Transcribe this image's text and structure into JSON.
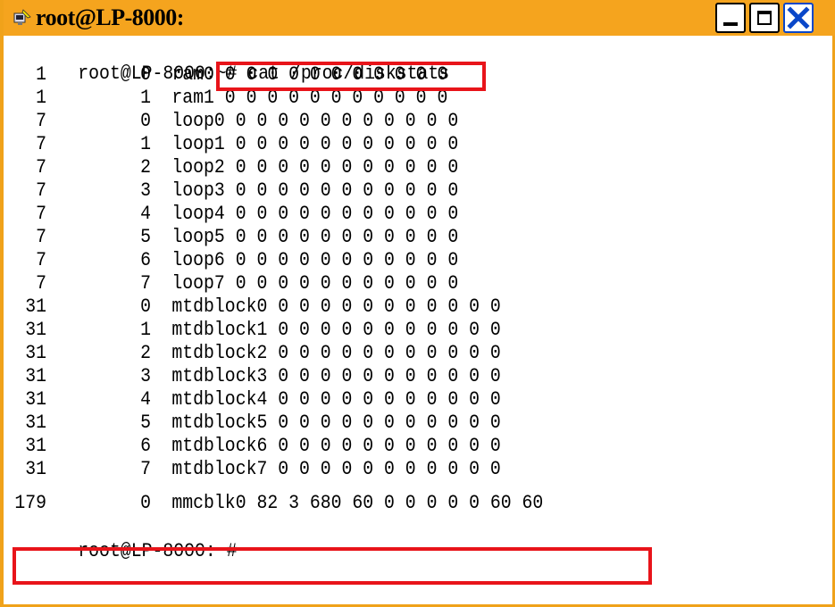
{
  "window": {
    "title": "root@LP-8000:",
    "controls": [
      "minimize",
      "maximize",
      "close"
    ],
    "accent_color": "#f5a41e",
    "highlight_color": "#e8141a"
  },
  "terminal": {
    "prompt": "root@LP-8000:~#",
    "command": "cat /proc/diskstats",
    "rows": [
      {
        "major": "1",
        "minor": "0",
        "rest": "ram0 0 0 0 0 0 0 0 0 0 0 0"
      },
      {
        "major": "1",
        "minor": "1",
        "rest": "ram1 0 0 0 0 0 0 0 0 0 0 0"
      },
      {
        "major": "7",
        "minor": "0",
        "rest": "loop0 0 0 0 0 0 0 0 0 0 0 0"
      },
      {
        "major": "7",
        "minor": "1",
        "rest": "loop1 0 0 0 0 0 0 0 0 0 0 0"
      },
      {
        "major": "7",
        "minor": "2",
        "rest": "loop2 0 0 0 0 0 0 0 0 0 0 0"
      },
      {
        "major": "7",
        "minor": "3",
        "rest": "loop3 0 0 0 0 0 0 0 0 0 0 0"
      },
      {
        "major": "7",
        "minor": "4",
        "rest": "loop4 0 0 0 0 0 0 0 0 0 0 0"
      },
      {
        "major": "7",
        "minor": "5",
        "rest": "loop5 0 0 0 0 0 0 0 0 0 0 0"
      },
      {
        "major": "7",
        "minor": "6",
        "rest": "loop6 0 0 0 0 0 0 0 0 0 0 0"
      },
      {
        "major": "7",
        "minor": "7",
        "rest": "loop7 0 0 0 0 0 0 0 0 0 0 0"
      },
      {
        "major": "31",
        "minor": "0",
        "rest": "mtdblock0 0 0 0 0 0 0 0 0 0 0 0"
      },
      {
        "major": "31",
        "minor": "1",
        "rest": "mtdblock1 0 0 0 0 0 0 0 0 0 0 0"
      },
      {
        "major": "31",
        "minor": "2",
        "rest": "mtdblock2 0 0 0 0 0 0 0 0 0 0 0"
      },
      {
        "major": "31",
        "minor": "3",
        "rest": "mtdblock3 0 0 0 0 0 0 0 0 0 0 0"
      },
      {
        "major": "31",
        "minor": "4",
        "rest": "mtdblock4 0 0 0 0 0 0 0 0 0 0 0"
      },
      {
        "major": "31",
        "minor": "5",
        "rest": "mtdblock5 0 0 0 0 0 0 0 0 0 0 0"
      },
      {
        "major": "31",
        "minor": "6",
        "rest": "mtdblock6 0 0 0 0 0 0 0 0 0 0 0"
      },
      {
        "major": "31",
        "minor": "7",
        "rest": "mtdblock7 0 0 0 0 0 0 0 0 0 0 0"
      },
      {
        "major": "179",
        "minor": "0",
        "rest": "mmcblk0 82 3 680 60 0 0 0 0 0 60 60"
      }
    ],
    "final_prompt": "root@LP-8000:~#"
  }
}
